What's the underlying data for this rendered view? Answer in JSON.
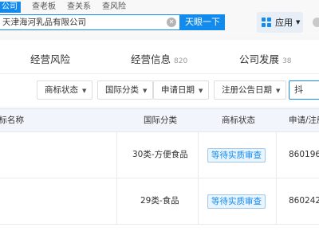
{
  "header": {
    "search_tabs": [
      "公司",
      "查老板",
      "查关系",
      "查风险"
    ],
    "search_value": "天津海河乳品有限公司",
    "search_button": "天眼一下",
    "apps_label": "应用",
    "accent_color": "#128bed"
  },
  "sections": [
    {
      "label": "经营风险",
      "count": ""
    },
    {
      "label": "经营信息",
      "count": "820"
    },
    {
      "label": "公司发展",
      "count": "38"
    }
  ],
  "filters": {
    "buttons": [
      "商标状态",
      "国际分类",
      "申请日期",
      "注册公告日期"
    ],
    "search_value": "抖"
  },
  "table": {
    "columns": [
      "商标名称",
      "国际分类",
      "商标状态",
      "申请/注册号"
    ],
    "rows": [
      {
        "name": "",
        "class": "30类-方便食品",
        "status": "等待实质审查",
        "reg_no": "860196"
      },
      {
        "name": "",
        "class": "29类-食品",
        "status": "等待实质审查",
        "reg_no": "860242"
      }
    ]
  }
}
